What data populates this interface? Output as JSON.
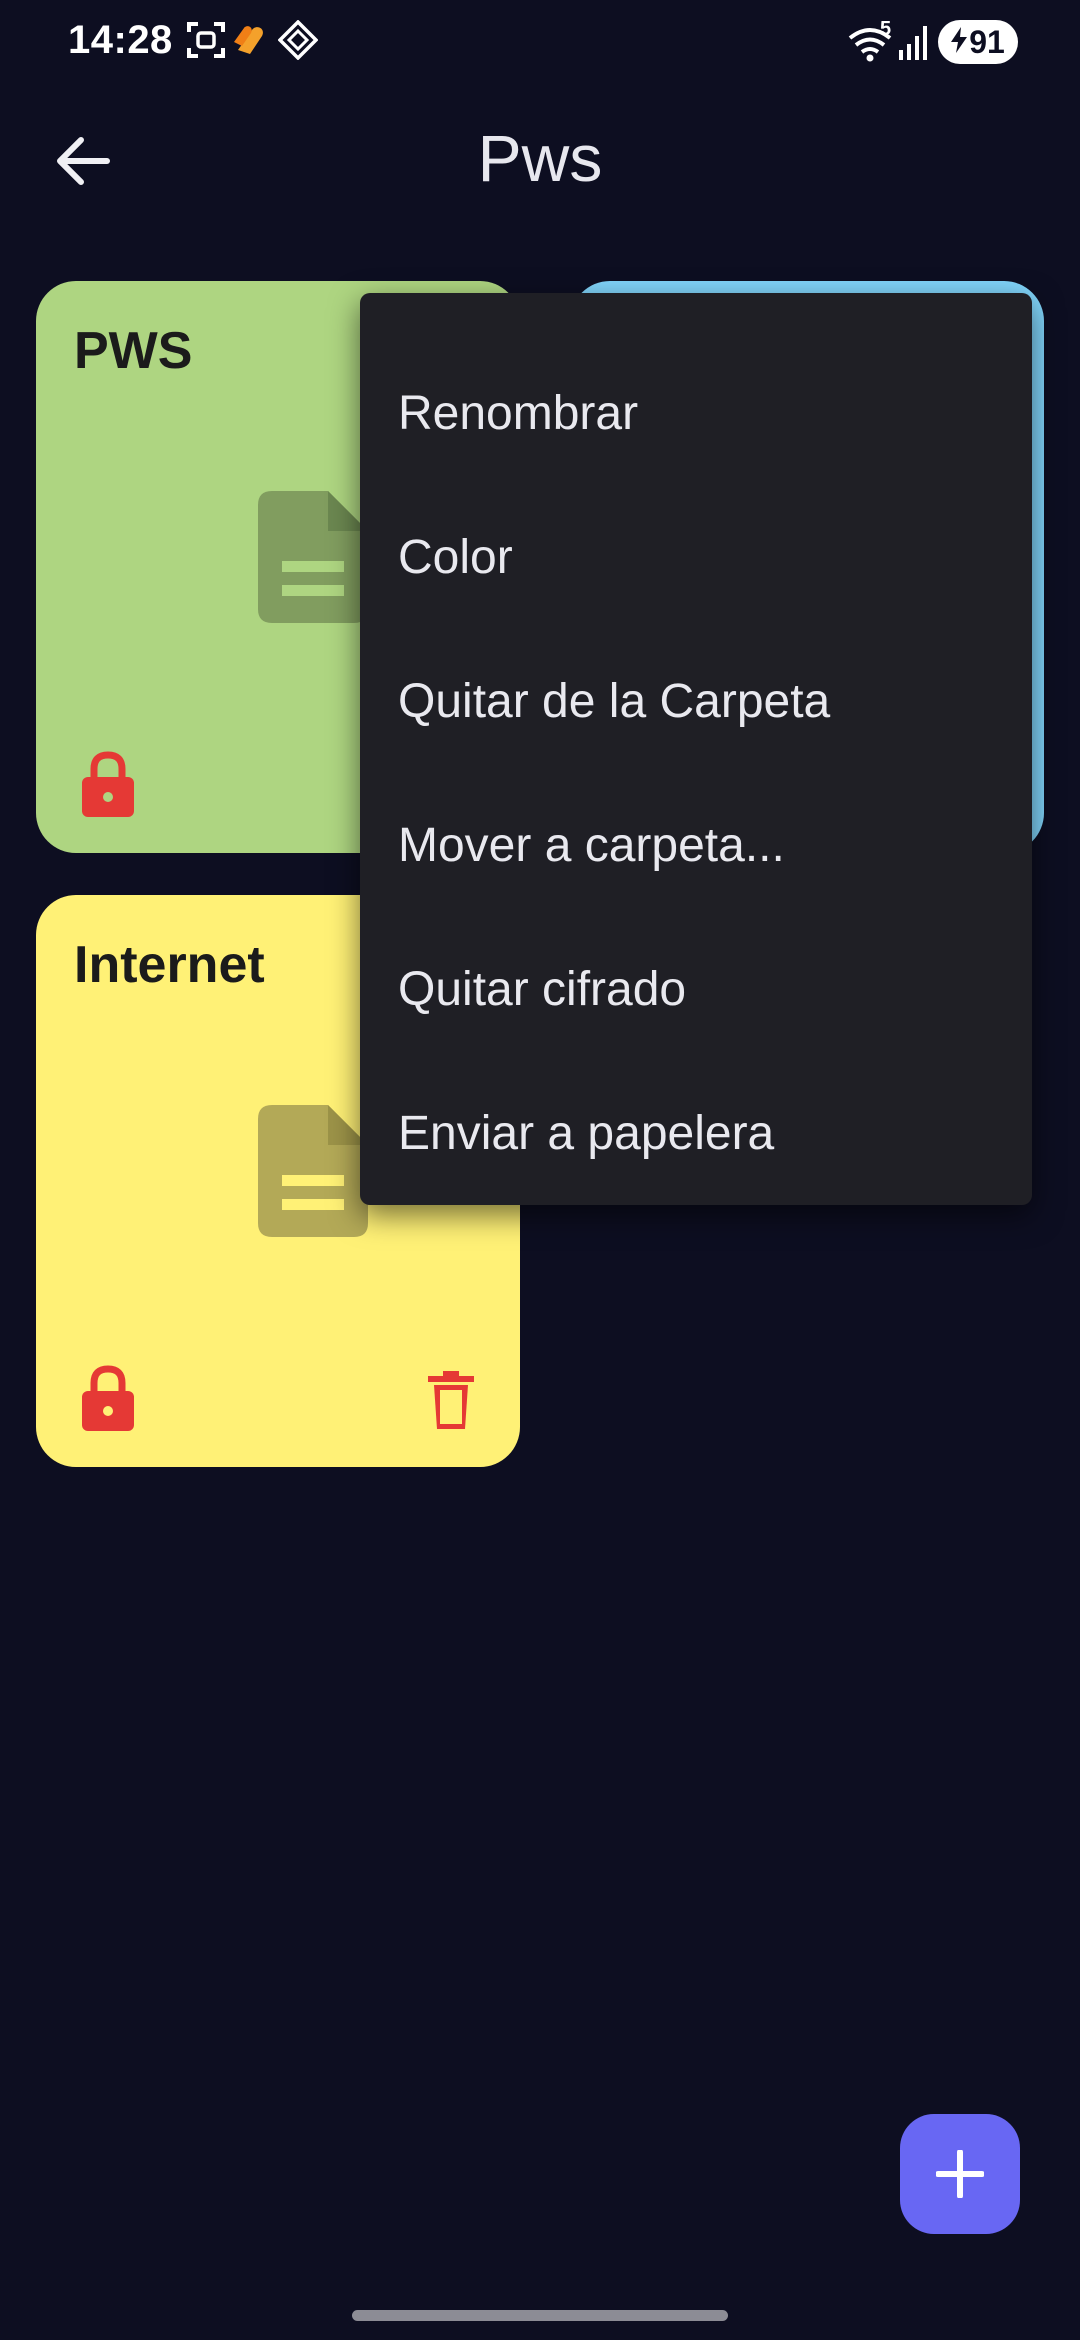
{
  "status_bar": {
    "time": "14:28",
    "battery": "91",
    "network_label": "5",
    "icons": [
      "screenshot-icon",
      "hearts-icon",
      "diamond-app-icon",
      "wifi-icon",
      "signal-icon",
      "battery-charging-icon"
    ]
  },
  "app_bar": {
    "title": "Pws",
    "back_icon": "arrow-back-icon"
  },
  "cards": [
    {
      "title": "PWS",
      "color": "#aed581",
      "icons": [
        "document-icon",
        "lock-icon"
      ]
    },
    {
      "title": "",
      "color": "#81d4fa",
      "icons": []
    },
    {
      "title": "Internet",
      "color": "#fff176",
      "icons": [
        "document-icon",
        "lock-icon",
        "trash-icon"
      ]
    }
  ],
  "menu": {
    "items": [
      {
        "label": "Renombrar"
      },
      {
        "label": "Color"
      },
      {
        "label": "Quitar de la Carpeta"
      },
      {
        "label": "Mover a carpeta..."
      },
      {
        "label": "Quitar cifrado"
      },
      {
        "label": "Enviar a papelera"
      }
    ]
  },
  "fab": {
    "icon": "plus-icon"
  },
  "colors": {
    "background": "#0d0e21",
    "menu_background": "#1f1f25",
    "accent": "#6867f3",
    "lock_red": "#e53935"
  }
}
